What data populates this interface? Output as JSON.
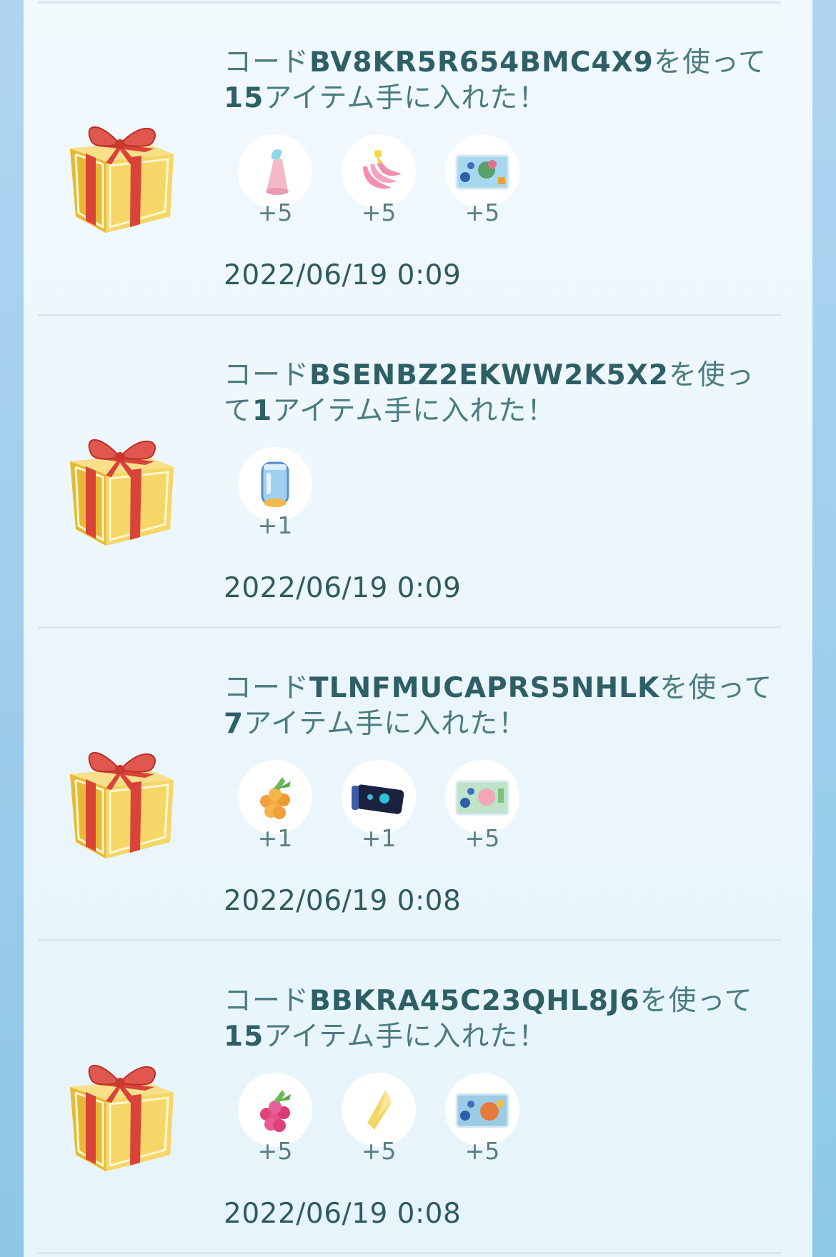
{
  "entries": [
    {
      "title_prefix": "コード",
      "code": "BV8KR5R654BMC4X9",
      "title_middle": "を使って",
      "count": "15",
      "title_suffix": "アイテム手に入れた！",
      "items": [
        {
          "icon": "incense-icon",
          "amount": "+5"
        },
        {
          "icon": "nanab-berry-icon",
          "amount": "+5"
        },
        {
          "icon": "sticker-icon",
          "amount": "+5"
        }
      ],
      "timestamp": "2022/06/19 0:09"
    },
    {
      "title_prefix": "コード",
      "code": "BSENBZ2EKWW2K5X2",
      "title_middle": "を使って",
      "count": "1",
      "title_suffix": "アイテム手に入れた！",
      "items": [
        {
          "icon": "incubator-icon",
          "amount": "+1"
        }
      ],
      "timestamp": "2022/06/19 0:09"
    },
    {
      "title_prefix": "コード",
      "code": "TLNFMUCAPRS5NHLK",
      "title_middle": "を使って",
      "count": "7",
      "title_suffix": "アイテム手に入れた！",
      "items": [
        {
          "icon": "golden-razz-berry-icon",
          "amount": "+1"
        },
        {
          "icon": "rocket-radar-icon",
          "amount": "+1"
        },
        {
          "icon": "sticker-icon",
          "amount": "+5"
        }
      ],
      "timestamp": "2022/06/19 0:08"
    },
    {
      "title_prefix": "コード",
      "code": "BBKRA45C23QHL8J6",
      "title_middle": "を使って",
      "count": "15",
      "title_suffix": "アイテム手に入れた！",
      "items": [
        {
          "icon": "razz-berry-icon",
          "amount": "+5"
        },
        {
          "icon": "star-piece-icon",
          "amount": "+5"
        },
        {
          "icon": "sticker-icon",
          "amount": "+5"
        }
      ],
      "timestamp": "2022/06/19 0:08"
    }
  ]
}
